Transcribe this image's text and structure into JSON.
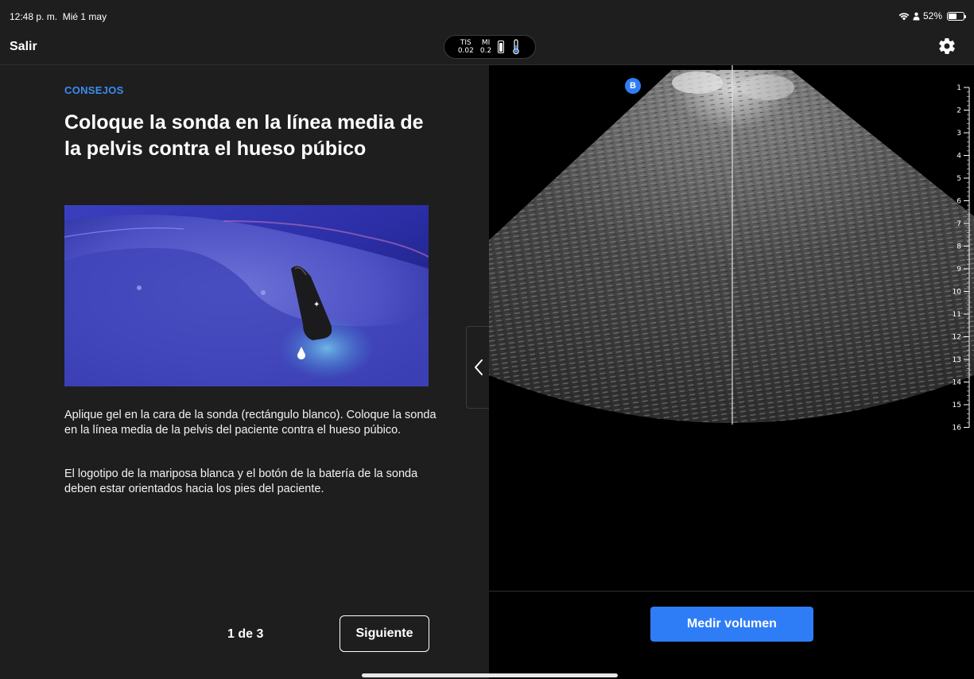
{
  "status_bar": {
    "time": "12:48 p. m.",
    "date": "Mié 1 may",
    "battery_percent": "52%",
    "icons": [
      "wifi-icon",
      "person-icon",
      "battery-icon"
    ]
  },
  "nav": {
    "exit_label": "Salir",
    "tis_label": "TIS",
    "tis_value": "0.02",
    "mi_label": "MI",
    "mi_value": "0.2",
    "settings_icon": "gear-icon"
  },
  "tips": {
    "section_label": "CONSEJOS",
    "title": "Coloque la sonda en la línea media de la pelvis contra el hueso púbico",
    "illustration_icon": "probe-placement-illustration",
    "body_1": "Aplique gel en la cara de la sonda (rectángulo blanco). Coloque la sonda en la línea media de la pelvis del paciente contra el hueso púbico.",
    "body_2": "El logotipo de la mariposa blanca y el botón de la batería de la sonda deben estar orientados hacia los pies del paciente.",
    "page_indicator": "1 de 3",
    "next_label": "Siguiente"
  },
  "scan": {
    "mode_badge": "B",
    "depth_labels": [
      "1",
      "2",
      "3",
      "4",
      "5",
      "6",
      "7",
      "8",
      "9",
      "10",
      "11",
      "12",
      "13",
      "14",
      "15",
      "16"
    ],
    "measure_label": "Medir volumen"
  },
  "colors": {
    "accent_blue": "#2f7df6",
    "tips_label_blue": "#3d8bf2",
    "panel_dark": "#1e1e1e",
    "scan_background": "#000000"
  }
}
